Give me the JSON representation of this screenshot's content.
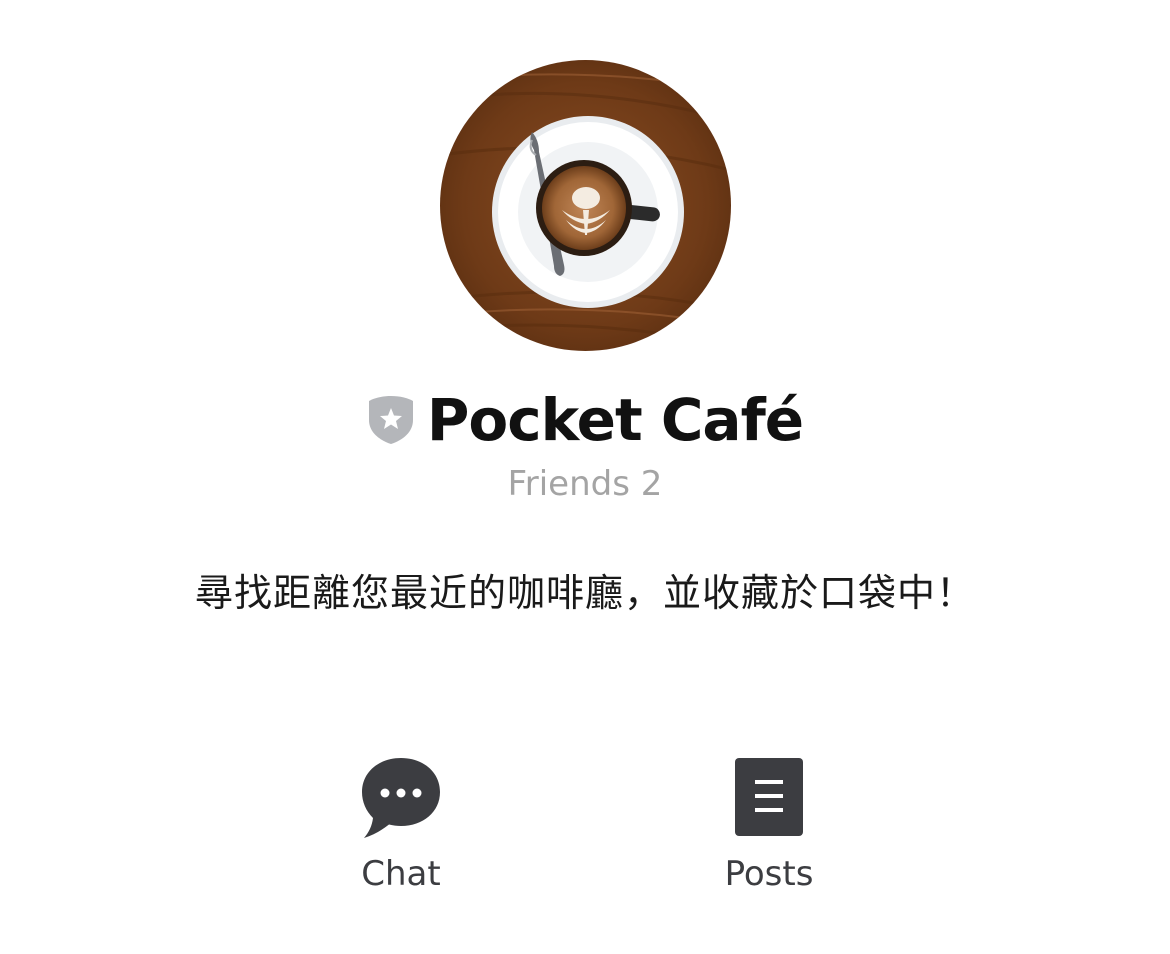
{
  "profile": {
    "avatar_icon": "coffee-latte-avatar",
    "badge_icon": "shield-star-icon",
    "name": "Pocket Café",
    "friends": "Friends 2",
    "description": "尋找距離您最近的咖啡廳，並收藏於口袋中！"
  },
  "actions": {
    "chat": {
      "label": "Chat",
      "icon": "chat-bubble-icon"
    },
    "posts": {
      "label": "Posts",
      "icon": "posts-document-icon"
    }
  },
  "colors": {
    "text": "#111111",
    "muted": "#a4a4a4",
    "icon_dark": "#3c3d41",
    "badge_grey": "#b4b6ba"
  }
}
